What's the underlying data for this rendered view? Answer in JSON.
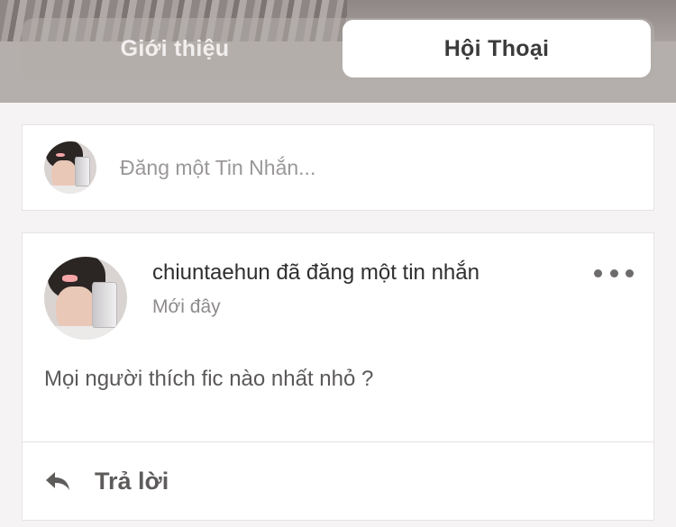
{
  "tabs": {
    "intro_label": "Giới thiệu",
    "conversation_label": "Hội Thoại",
    "active": "conversation"
  },
  "composer": {
    "placeholder": "Đăng một Tin Nhắn..."
  },
  "post": {
    "title": "chiuntaehun đã đăng một tin nhắn",
    "time": "Mới đây",
    "body": "Mọi người thích fic nào nhất nhỏ ?",
    "reply_label": "Trả lời",
    "more_icon": "more-horizontal-icon",
    "reply_icon": "reply-arrow-icon"
  },
  "colors": {
    "header_bg": "#b4aeac",
    "active_tab_bg": "#ffffff",
    "page_bg": "#f5f3f3"
  }
}
